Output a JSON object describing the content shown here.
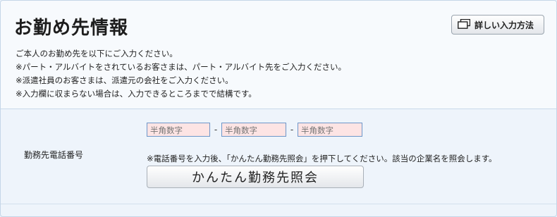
{
  "section": {
    "title": "お勤め先情報",
    "detail_button_label": "詳しい入力方法",
    "notes": [
      "ご本人のお勤め先を以下にご入力ください。",
      "※パート・アルバイトをされているお客さまは、パート・アルバイト先をご入力ください。",
      "※派遣社員のお客さまは、派遣元の会社をご入力ください。",
      "※入力欄に収まらない場合は、入力できるところまでで結構です。"
    ]
  },
  "phone_row": {
    "label": "勤務先電話番号",
    "placeholders": [
      "半角数字",
      "半角数字",
      "半角数字"
    ],
    "separator": "-",
    "note": "※電話番号を入力後、「かんたん勤務先照会」を押下してください。該当の企業名を照会します。",
    "lookup_button_label": "かんたん勤務先照会"
  },
  "colors": {
    "input_bg": "#fde4e4",
    "input_border": "#6d96c9",
    "header_bg": "#f7fafd",
    "row_bg": "#eef4fb"
  }
}
